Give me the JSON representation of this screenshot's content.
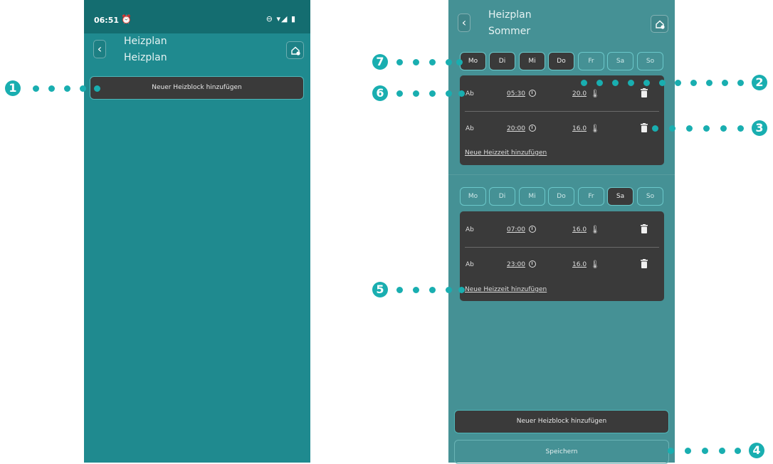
{
  "left_phone": {
    "status_bar": {
      "time": "06:51",
      "alarm_icon": "alarm-icon",
      "right_icons": "⊖ ▾◢ ▮"
    },
    "header": {
      "title_line1": "Heizplan",
      "title_line2": "Heizplan"
    },
    "add_block_label": "Neuer Heizblock hinzufügen"
  },
  "right_phone": {
    "header": {
      "title_line1": "Heizplan",
      "title_line2": "Sommer"
    },
    "blocks": [
      {
        "days": [
          {
            "label": "Mo",
            "active": true
          },
          {
            "label": "Di",
            "active": true
          },
          {
            "label": "Mi",
            "active": true
          },
          {
            "label": "Do",
            "active": true
          },
          {
            "label": "Fr",
            "active": false
          },
          {
            "label": "Sa",
            "active": false
          },
          {
            "label": "So",
            "active": false
          }
        ],
        "entries": [
          {
            "ab": "Ab",
            "time": "05:30",
            "temp": "20.0"
          },
          {
            "ab": "Ab",
            "time": "20:00",
            "temp": "16.0"
          }
        ],
        "add_time_label": "Neue Heizzeit hinzufügen"
      },
      {
        "days": [
          {
            "label": "Mo",
            "active": false
          },
          {
            "label": "Di",
            "active": false
          },
          {
            "label": "Mi",
            "active": false
          },
          {
            "label": "Do",
            "active": false
          },
          {
            "label": "Fr",
            "active": false
          },
          {
            "label": "Sa",
            "active": true
          },
          {
            "label": "So",
            "active": false
          }
        ],
        "entries": [
          {
            "ab": "Ab",
            "time": "07:00",
            "temp": "16.0"
          },
          {
            "ab": "Ab",
            "time": "23:00",
            "temp": "16.0"
          }
        ],
        "add_time_label": "Neue Heizzeit hinzufügen"
      }
    ],
    "add_block_label": "Neuer Heizblock hinzufügen",
    "save_label": "Speichern"
  },
  "annotations": {
    "a1": "1",
    "a2": "2",
    "a3": "3",
    "a4": "4",
    "a5": "5",
    "a6": "6",
    "a7": "7"
  },
  "colors": {
    "accent": "#19aeb0",
    "left_bg": "#1f8a8f",
    "right_bg": "#459195",
    "card": "#3a3a3a"
  }
}
